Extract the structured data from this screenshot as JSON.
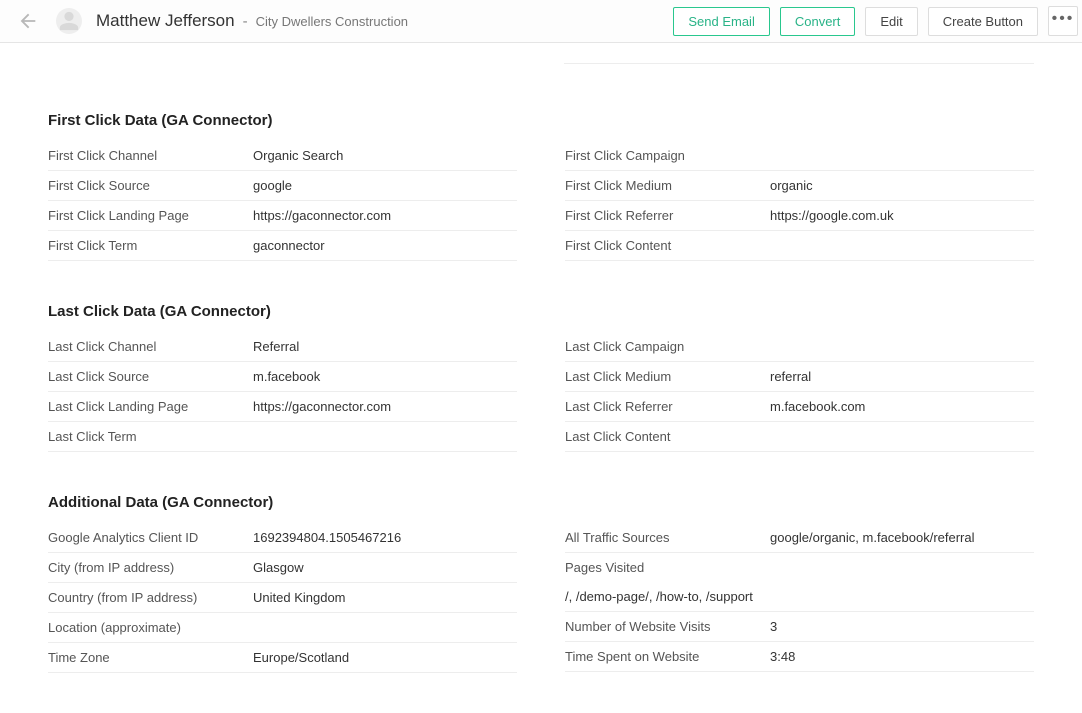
{
  "header": {
    "person_name": "Matthew Jefferson",
    "company_name": "City Dwellers Construction",
    "btn_send_email": "Send Email",
    "btn_convert": "Convert",
    "btn_edit": "Edit",
    "btn_create": "Create Button"
  },
  "sections": {
    "first_click_title": "First Click Data (GA Connector)",
    "last_click_title": "Last Click Data (GA Connector)",
    "additional_title": "Additional Data (GA Connector)"
  },
  "first_click": {
    "left": {
      "channel_label": "First Click Channel",
      "channel_value": "Organic Search",
      "source_label": "First Click Source",
      "source_value": "google",
      "landing_label": "First Click Landing Page",
      "landing_value": "https://gaconnector.com",
      "term_label": "First Click Term",
      "term_value": "gaconnector"
    },
    "right": {
      "campaign_label": "First Click Campaign",
      "campaign_value": "",
      "medium_label": "First Click Medium",
      "medium_value": "organic",
      "referrer_label": "First Click Referrer",
      "referrer_value": "https://google.com.uk",
      "content_label": "First Click Content",
      "content_value": ""
    }
  },
  "last_click": {
    "left": {
      "channel_label": "Last Click Channel",
      "channel_value": "Referral",
      "source_label": "Last Click Source",
      "source_value": "m.facebook",
      "landing_label": "Last Click Landing Page",
      "landing_value": "https://gaconnector.com",
      "term_label": "Last Click Term",
      "term_value": ""
    },
    "right": {
      "campaign_label": "Last Click Campaign",
      "campaign_value": "",
      "medium_label": "Last Click Medium",
      "medium_value": "referral",
      "referrer_label": "Last Click Referrer",
      "referrer_value": "m.facebook.com",
      "content_label": "Last Click Content",
      "content_value": ""
    }
  },
  "additional": {
    "left": {
      "ga_client_label": "Google Analytics Client ID",
      "ga_client_value": "1692394804.1505467216",
      "city_label": "City (from IP address)",
      "city_value": "Glasgow",
      "country_label": "Country (from IP address)",
      "country_value": "United Kingdom",
      "location_label": "Location (approximate)",
      "location_value": "",
      "tz_label": "Time Zone",
      "tz_value": "Europe/Scotland"
    },
    "right": {
      "traffic_label": "All Traffic Sources",
      "traffic_value": "google/organic, m.facebook/referral",
      "pages_label": "Pages Visited",
      "pages_value": "/, /demo-page/, /how-to, /support",
      "visits_label": "Number of Website Visits",
      "visits_value": "3",
      "time_label": "Time Spent on Website",
      "time_value": "3:48"
    }
  }
}
